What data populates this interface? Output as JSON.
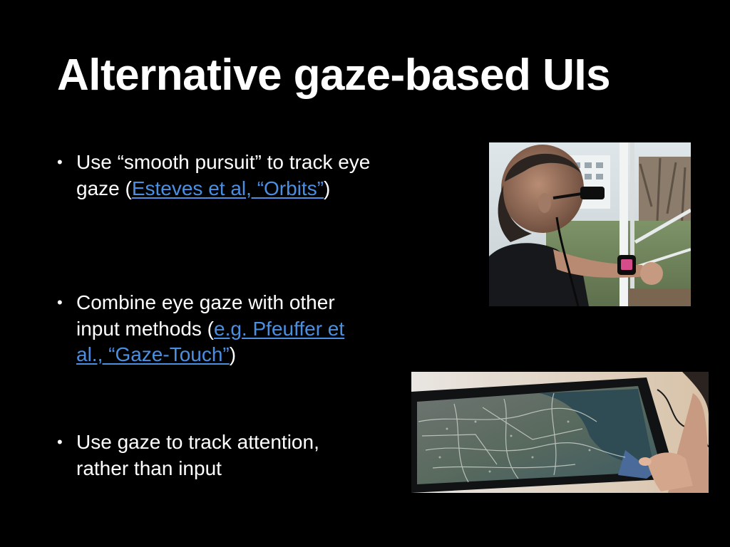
{
  "slide": {
    "title": "Alternative gaze-based UIs",
    "bullets": [
      {
        "text_before": "Use “smooth pursuit” to track eye gaze (",
        "link": "Esteves et al, “Orbits”",
        "text_after": ")"
      },
      {
        "text_before": "Combine eye gaze with other input methods (",
        "link": "e.g. Pfeuffer et al., “Gaze-Touch”",
        "text_after": ")"
      },
      {
        "text_before": "Use gaze to track attention, rather than input",
        "link": "",
        "text_after": ""
      }
    ],
    "bullet_glyph": "•"
  },
  "colors": {
    "background": "#000000",
    "text": "#ffffff",
    "link": "#4a8fe2"
  }
}
